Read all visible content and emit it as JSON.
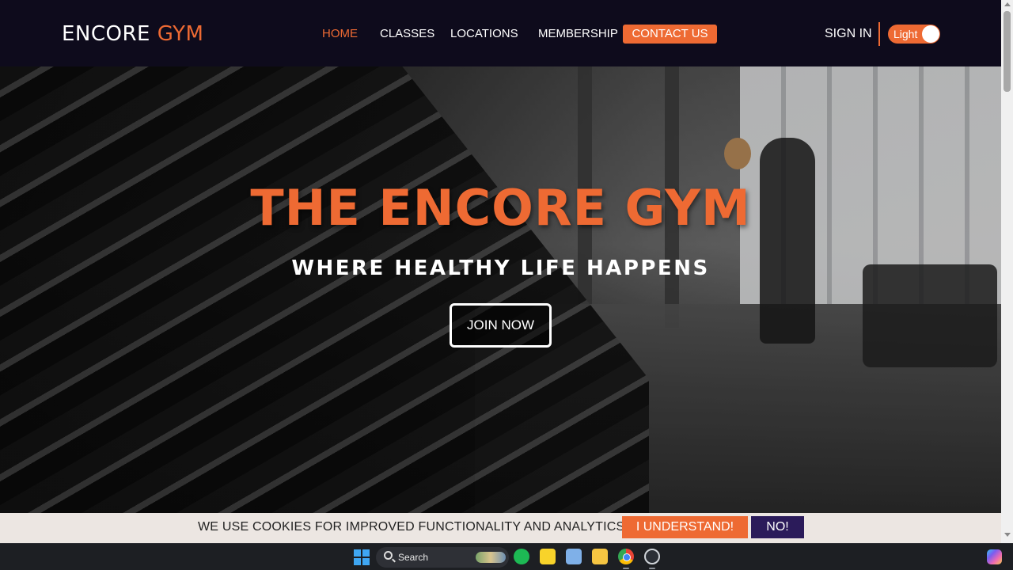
{
  "brand": {
    "name_part1": "ENCORE",
    "name_part2": "GYM",
    "accent_color": "#ee6a33",
    "dark_color": "#0e0b1c"
  },
  "nav": {
    "items": [
      {
        "label": "HOME",
        "active": true
      },
      {
        "label": "CLASSES",
        "active": false
      },
      {
        "label": "LOCATIONS",
        "active": false
      },
      {
        "label": "MEMBERSHIP",
        "active": false
      }
    ],
    "contact_label": "CONTACT US",
    "signin_label": "SIGN IN",
    "theme_toggle_label": "Light"
  },
  "hero": {
    "title": "THE ENCORE GYM",
    "subtitle": "WHERE HEALTHY LIFE HAPPENS",
    "cta_label": "JOIN NOW"
  },
  "cookie": {
    "message": "WE USE COOKIES FOR IMPROVED FUNCTIONALITY AND ANALYTICS.",
    "accept_label": "I UNDERSTAND!",
    "decline_label": "NO!",
    "accept_color": "#ee6a33",
    "decline_color": "#2b1b5a"
  },
  "taskbar": {
    "search_label": "Search",
    "apps": [
      "windows-start-icon",
      "spotify-icon",
      "sticky-notes-icon",
      "snipping-tool-icon",
      "file-explorer-icon",
      "chrome-icon",
      "app-icon",
      "copilot-icon"
    ]
  }
}
